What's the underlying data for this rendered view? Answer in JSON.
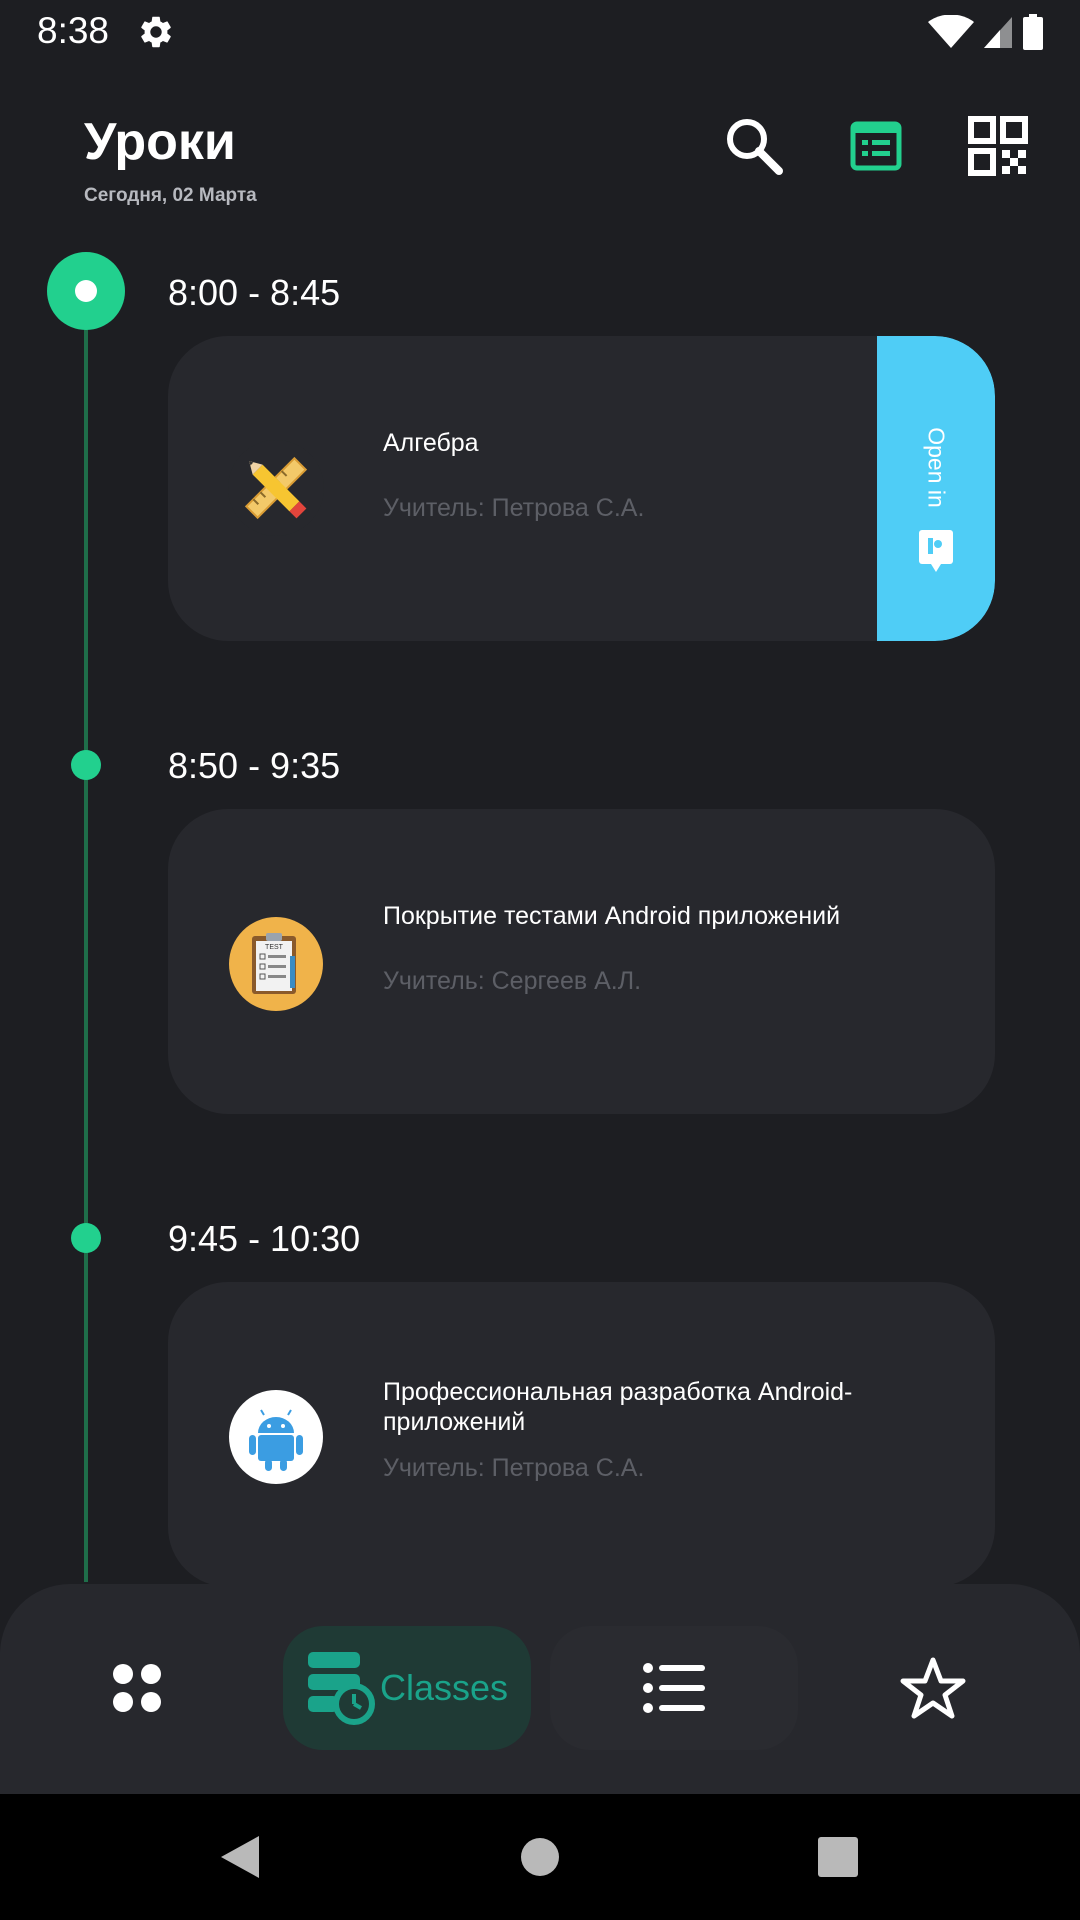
{
  "status_bar": {
    "time": "8:38",
    "icons": [
      "settings-icon",
      "wifi-icon",
      "signal-icon",
      "battery-icon"
    ]
  },
  "header": {
    "title": "Уроки",
    "date": "Сегодня, 02 Марта",
    "actions": [
      "search-icon",
      "schedule-list-icon",
      "qr-code-icon"
    ],
    "accent_color": "#22d08e"
  },
  "lessons": [
    {
      "time": "8:00 - 8:45",
      "title": "Алгебра",
      "teacher": "Учитель: Петрова С.А.",
      "icon": "ruler-pencil-icon",
      "current": true,
      "action": {
        "label": "Open in",
        "icon": "presentation-icon",
        "color": "#4fcdf6"
      }
    },
    {
      "time": "8:50 - 9:35",
      "title": "Покрытие тестами Android приложений",
      "teacher": "Учитель: Сергеев А.Л.",
      "icon": "test-clipboard-icon",
      "current": false
    },
    {
      "time": "9:45 - 10:30",
      "title": "Профессиональная разработка Android-приложений",
      "teacher": "Учитель: Петрова С.А.",
      "icon": "android-icon",
      "current": false
    }
  ],
  "bottom_nav": {
    "items": [
      {
        "icon": "apps-grid-icon",
        "label": ""
      },
      {
        "icon": "classes-icon",
        "label": "Classes",
        "selected": true
      },
      {
        "icon": "list-icon",
        "label": ""
      },
      {
        "icon": "star-icon",
        "label": ""
      }
    ]
  },
  "system_nav": [
    "back-icon",
    "home-icon",
    "recents-icon"
  ]
}
